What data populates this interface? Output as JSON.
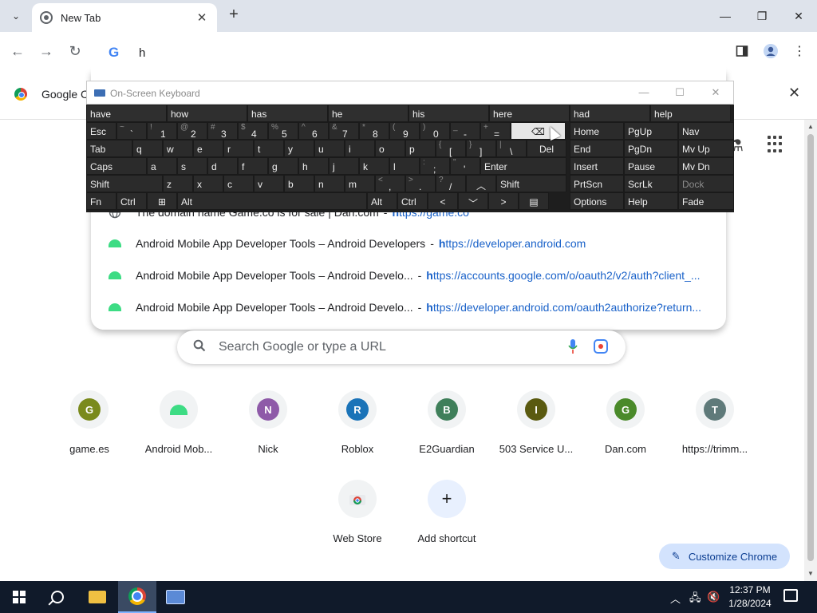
{
  "browser": {
    "tab": {
      "title": "New Tab",
      "close": "✕"
    },
    "new_tab": "+",
    "window": {
      "minimize": "—",
      "restore": "❐",
      "close": "✕"
    },
    "omnibox": {
      "text": "h"
    },
    "infobar": {
      "text": "Google Ch"
    }
  },
  "dropdown": {
    "suggestions": [
      {
        "title": "The domain name Game.co is for sale | Dan.com",
        "sep": "-",
        "url_bold": "h",
        "url_rest": "ttps://game.co",
        "icon": "globe-icon"
      },
      {
        "title": "Android Mobile App Developer Tools – Android Developers",
        "sep": "-",
        "url_bold": "h",
        "url_rest": "ttps://developer.android.com",
        "icon": "android-icon"
      },
      {
        "title": "Android Mobile App Developer Tools – Android Develo...",
        "sep": "-",
        "url_bold": "h",
        "url_rest": "ttps://accounts.google.com/o/oauth2/v2/auth?client_...",
        "icon": "android-icon"
      },
      {
        "title": "Android Mobile App Developer Tools – Android Develo...",
        "sep": "-",
        "url_bold": "h",
        "url_rest": "ttps://developer.android.com/oauth2authorize?return...",
        "icon": "android-icon"
      }
    ]
  },
  "search": {
    "placeholder": "Search Google or type a URL"
  },
  "shortcuts": [
    {
      "label": "game.es",
      "letter": "G",
      "color": "#7a8a1c"
    },
    {
      "label": "Android Mob...",
      "letter": "",
      "color": "#3ddc84"
    },
    {
      "label": "Nick",
      "letter": "N",
      "color": "#8e5aa8"
    },
    {
      "label": "Roblox",
      "letter": "R",
      "color": "#1a73b8"
    },
    {
      "label": "E2Guardian",
      "letter": "B",
      "color": "#3f7f5a"
    },
    {
      "label": "503 Service U...",
      "letter": "I",
      "color": "#5a5a10"
    },
    {
      "label": "Dan.com",
      "letter": "G",
      "color": "#4a8a2a"
    },
    {
      "label": "https://trimm...",
      "letter": "T",
      "color": "#5f7a7a"
    },
    {
      "label": "Web Store",
      "letter": "",
      "color": "#f1f3f4"
    },
    {
      "label": "Add shortcut",
      "letter": "+",
      "color": "#d3e3fd"
    }
  ],
  "customize": {
    "label": "Customize Chrome"
  },
  "osk": {
    "title": "On-Screen Keyboard",
    "controls": {
      "minimize": "—",
      "maximize": "☐",
      "close": "✕"
    },
    "predictions": [
      "have",
      "how",
      "has",
      "he",
      "his",
      "here",
      "had",
      "help"
    ],
    "row1": [
      {
        "top": "",
        "main": "Esc"
      },
      {
        "top": "~",
        "main": "`"
      },
      {
        "top": "!",
        "main": "1"
      },
      {
        "top": "@",
        "main": "2"
      },
      {
        "top": "#",
        "main": "3"
      },
      {
        "top": "$",
        "main": "4"
      },
      {
        "top": "%",
        "main": "5"
      },
      {
        "top": "^",
        "main": "6"
      },
      {
        "top": "&",
        "main": "7"
      },
      {
        "top": "*",
        "main": "8"
      },
      {
        "top": "(",
        "main": "9"
      },
      {
        "top": ")",
        "main": "0"
      },
      {
        "top": "_",
        "main": "-"
      },
      {
        "top": "+",
        "main": "="
      },
      {
        "top": "",
        "main": "⌫"
      }
    ],
    "row2": [
      "Tab",
      "q",
      "w",
      "e",
      "r",
      "t",
      "y",
      "u",
      "i",
      "o",
      "p"
    ],
    "row2_brackets": [
      {
        "top": "{",
        "main": "["
      },
      {
        "top": "}",
        "main": "]"
      },
      {
        "top": "|",
        "main": "\\"
      }
    ],
    "row2_del": "Del",
    "row3": [
      "Caps",
      "a",
      "s",
      "d",
      "f",
      "g",
      "h",
      "j",
      "k",
      "l"
    ],
    "row3_punct": [
      {
        "top": ":",
        "main": ";"
      },
      {
        "top": "\"",
        "main": "'"
      }
    ],
    "row3_enter": "Enter",
    "row4": [
      "Shift",
      "z",
      "x",
      "c",
      "v",
      "b",
      "n",
      "m"
    ],
    "row4_punct": [
      {
        "top": "<",
        "main": ","
      },
      {
        "top": ">",
        "main": "."
      },
      {
        "top": "?",
        "main": "/"
      }
    ],
    "row4_up": "︿",
    "row4_shift": "Shift",
    "row5": {
      "fn": "Fn",
      "ctrl": "Ctrl",
      "win": "⊞",
      "alt": "Alt",
      "alt_r": "Alt",
      "ctrl_r": "Ctrl",
      "left": "<",
      "down": "﹀",
      "right": ">",
      "menu": "▤"
    },
    "nav": [
      [
        "Home",
        "PgUp",
        "Nav"
      ],
      [
        "End",
        "PgDn",
        "Mv Up"
      ],
      [
        "Insert",
        "Pause",
        "Mv Dn"
      ],
      [
        "PrtScn",
        "ScrLk",
        "Dock"
      ],
      [
        "Options",
        "Help",
        "Fade"
      ]
    ]
  },
  "taskbar": {
    "clock_time": "12:37 PM",
    "clock_date": "1/28/2024"
  }
}
